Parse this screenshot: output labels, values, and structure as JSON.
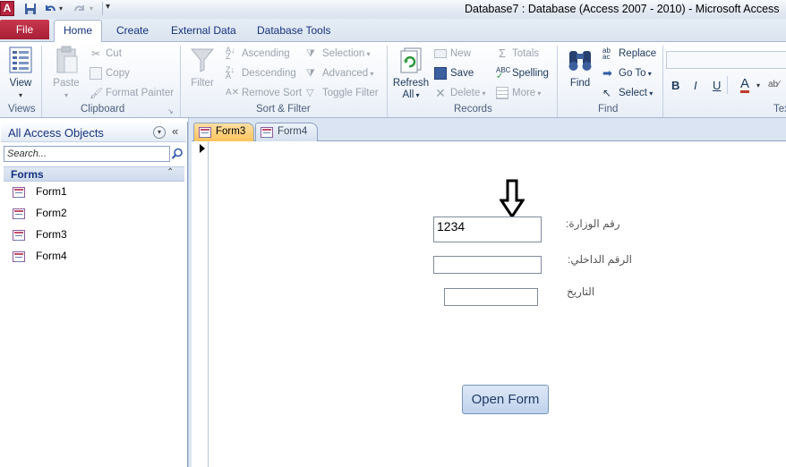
{
  "window": {
    "app_icon_letter": "A",
    "title": "Database7 : Database (Access 2007 - 2010)  -  Microsoft Access"
  },
  "ribbon_tabs": {
    "file": "File",
    "home": "Home",
    "create": "Create",
    "external": "External Data",
    "tools": "Database Tools"
  },
  "ribbon": {
    "views": {
      "view": "View",
      "label": "Views"
    },
    "clipboard": {
      "paste": "Paste",
      "cut": "Cut",
      "copy": "Copy",
      "format_painter": "Format Painter",
      "label": "Clipboard"
    },
    "sort_filter": {
      "filter": "Filter",
      "ascending": "Ascending",
      "descending": "Descending",
      "remove_sort": "Remove Sort",
      "selection": "Selection",
      "advanced": "Advanced",
      "toggle_filter": "Toggle Filter",
      "label": "Sort & Filter"
    },
    "records": {
      "refresh_line1": "Refresh",
      "refresh_line2": "All",
      "new": "New",
      "save": "Save",
      "delete": "Delete",
      "totals": "Totals",
      "spelling": "Spelling",
      "more": "More",
      "label": "Records"
    },
    "find": {
      "find": "Find",
      "replace": "Replace",
      "goto": "Go To",
      "select": "Select",
      "label": "Find"
    },
    "text": {
      "bold": "B",
      "italic": "I",
      "underline": "U",
      "font_color": "A",
      "label": "Tex"
    }
  },
  "nav_pane": {
    "title": "All Access Objects",
    "search_placeholder": "Search...",
    "group": "Forms",
    "items": [
      "Form1",
      "Form2",
      "Form3",
      "Form4"
    ]
  },
  "doc_tabs": [
    "Form3",
    "Form4"
  ],
  "form": {
    "field1_value": "1234",
    "field1_label": "رقم الوزارة:",
    "field2_value": "",
    "field2_label": "الرقم الداخلي:",
    "field3_value": "",
    "field3_label": "التاريخ",
    "button": "Open Form"
  },
  "colors": {
    "file_tab": "#b5263f",
    "active_doc_tab": "#ffc35c",
    "accent": "#15317e"
  }
}
